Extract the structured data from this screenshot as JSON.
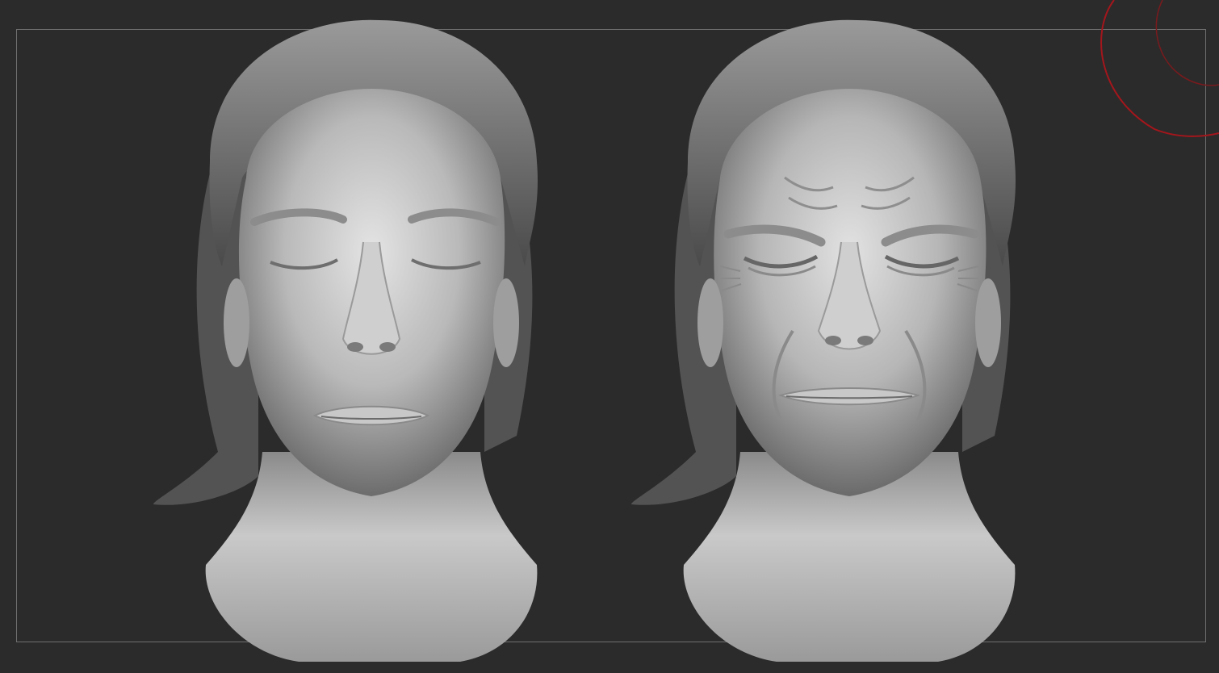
{
  "viewport": {
    "background_color": "#2b2b2b",
    "frame_color": "#6f6f6f"
  },
  "renders": [
    {
      "expression": "neutral",
      "eyes": "closed",
      "material_color": "#bdbdbd"
    },
    {
      "expression": "squint",
      "eyes": "squeezed",
      "material_color": "#bdbdbd"
    }
  ],
  "gizmo": {
    "color": "#a3161c",
    "icon": "rotation-gizmo-icon"
  }
}
